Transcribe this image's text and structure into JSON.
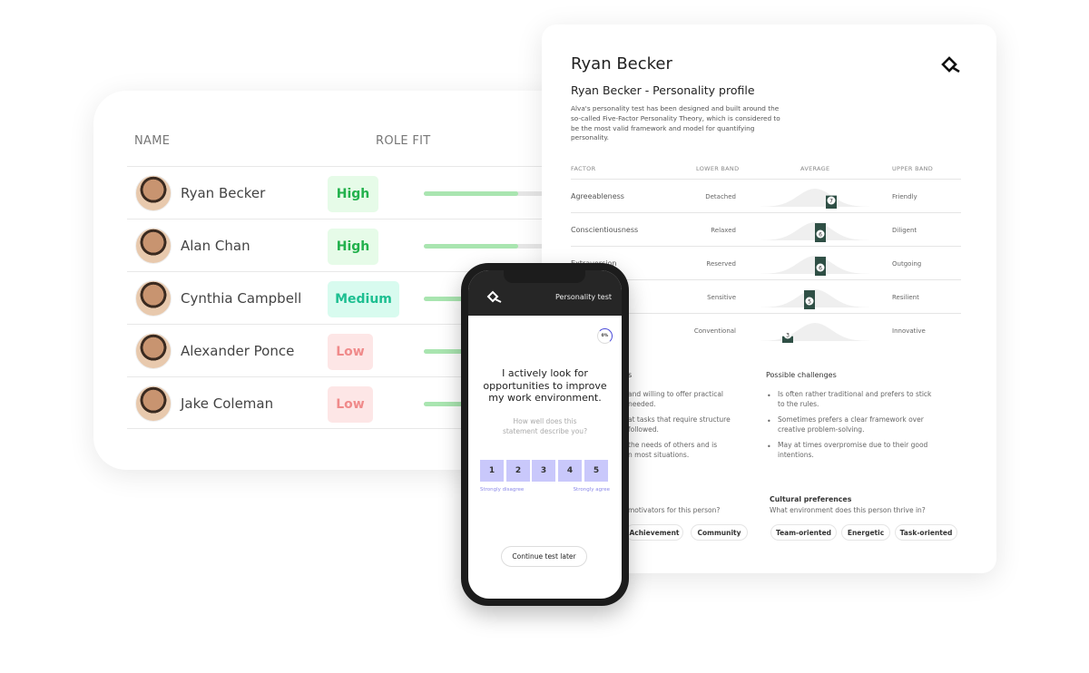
{
  "candidates": {
    "headers": {
      "name": "NAME",
      "role_fit": "ROLE FIT"
    },
    "rows": [
      {
        "name": "Ryan Becker",
        "fit": "High",
        "fit_color": "#22b14c",
        "fit_bg": "#e6fbe8",
        "progress": 0.52
      },
      {
        "name": "Alan Chan",
        "fit": "High",
        "fit_color": "#22b14c",
        "fit_bg": "#e6fbe8",
        "progress": 0.52
      },
      {
        "name": "Cynthia Campbell",
        "fit": "Medium",
        "fit_color": "#1dbf91",
        "fit_bg": "#d8fbef",
        "progress": 0.5
      },
      {
        "name": "Alexander Ponce",
        "fit": "Low",
        "fit_color": "#f08a8a",
        "fit_bg": "#fde6e6",
        "progress": 0.3
      },
      {
        "name": "Jake Coleman",
        "fit": "Low",
        "fit_color": "#f08a8a",
        "fit_bg": "#fde6e6",
        "progress": 0.3
      }
    ]
  },
  "profile": {
    "name": "Ryan Becker",
    "title": "Ryan Becker - Personality profile",
    "description": "Alva's personality test has been designed and built around the so-called Five-Factor Personality Theory, which is considered to be the most valid framework and model for quantifying personality.",
    "headers": {
      "factor": "FACTOR",
      "lower": "LOWER BAND",
      "average": "AVERAGE",
      "upper": "UPPER BAND"
    },
    "factors": [
      {
        "name": "Agreeableness",
        "lower": "Detached",
        "upper": "Friendly",
        "score": "7"
      },
      {
        "name": "Conscientiousness",
        "lower": "Relaxed",
        "upper": "Diligent",
        "score": "6"
      },
      {
        "name": "Extraversion",
        "lower": "Reserved",
        "upper": "Outgoing",
        "score": "6"
      },
      {
        "name": "y",
        "lower": "Sensitive",
        "upper": "Resilient",
        "score": "5"
      },
      {
        "name": "erience",
        "lower": "Conventional",
        "upper": "Innovative",
        "score": "3"
      }
    ],
    "strengths": {
      "heading": "s",
      "items": [
        "and willing to offer practical",
        "needed.",
        "at tasks that require structure",
        "followed.",
        "the needs of others and is",
        "n most situations."
      ]
    },
    "challenges": {
      "heading": "Possible challenges",
      "items": [
        "Is often rather traditional and prefers to stick to the rules.",
        "Sometimes prefers a clear framework over creative problem-solving.",
        "May at times overpromise due to their good intentions."
      ]
    },
    "motivators": {
      "question": "motivators for this person?",
      "tags": [
        "Achievement",
        "Community"
      ]
    },
    "culture": {
      "heading": "Cultural preferences",
      "question": "What environment does this person thrive in?",
      "tags": [
        "Team-oriented",
        "Energetic",
        "Task-oriented"
      ]
    },
    "marker_color": "#2f4f45"
  },
  "phone": {
    "title": "Personality test",
    "progress": "0%",
    "statement": "I actively look for opportunities to improve my work environment.",
    "prompt": "How well does this statement describe you?",
    "options": [
      "1",
      "2",
      "3",
      "4",
      "5"
    ],
    "low_label": "Strongly disagree",
    "high_label": "Strongly agree",
    "continue": "Continue test later",
    "accent": "#c9c8fb"
  }
}
